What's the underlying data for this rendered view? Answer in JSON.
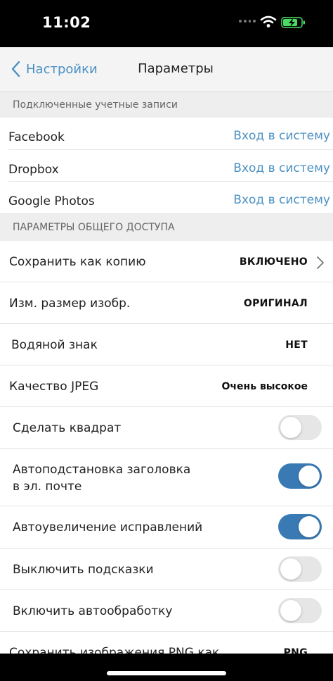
{
  "status_bar": {
    "time": "11:02",
    "icons": [
      "signal-dots-icon",
      "wifi-icon",
      "battery-charging-icon"
    ],
    "battery_color": "#4cd964"
  },
  "nav": {
    "back_label": "Настройки",
    "title": "Параметры",
    "accent_color": "#4a90c2"
  },
  "accounts": {
    "header": "Подключенные учетные записи",
    "items": [
      {
        "name": "Facebook",
        "action": "Вход в систему"
      },
      {
        "name": "Dropbox",
        "action": "Вход в систему"
      },
      {
        "name": "Google Photos",
        "action": "Вход в систему"
      }
    ]
  },
  "sharing": {
    "header": "ПАРАМЕТРЫ ОБЩЕГО ДОСТУПА",
    "save_copy": {
      "label": "Сохранить как копию",
      "value": "ВКЛЮЧЕНО"
    },
    "resize": {
      "label": "Изм. размер изобр.",
      "value": "ОРИГИНАЛ"
    },
    "watermark": {
      "label": "Водяной знак",
      "value": "НЕТ"
    },
    "jpeg": {
      "label": "Качество JPEG",
      "value": "Очень высокое"
    },
    "square": {
      "label": "Сделать квадрат",
      "on": false
    },
    "autosubject": {
      "label_line1": "Автоподстановка заголовка",
      "label_line2": "в эл. почте",
      "on": true
    },
    "autozoom": {
      "label": "Автоувеличение исправлений",
      "on": true
    },
    "hints": {
      "label": "Выключить подсказки",
      "on": false
    },
    "autoprocess": {
      "label": "Включить автообработку",
      "on": false
    },
    "png": {
      "label": "Сохранить изображения PNG как",
      "value": "PNG"
    },
    "toggle_on_color": "#3a7ab4"
  }
}
